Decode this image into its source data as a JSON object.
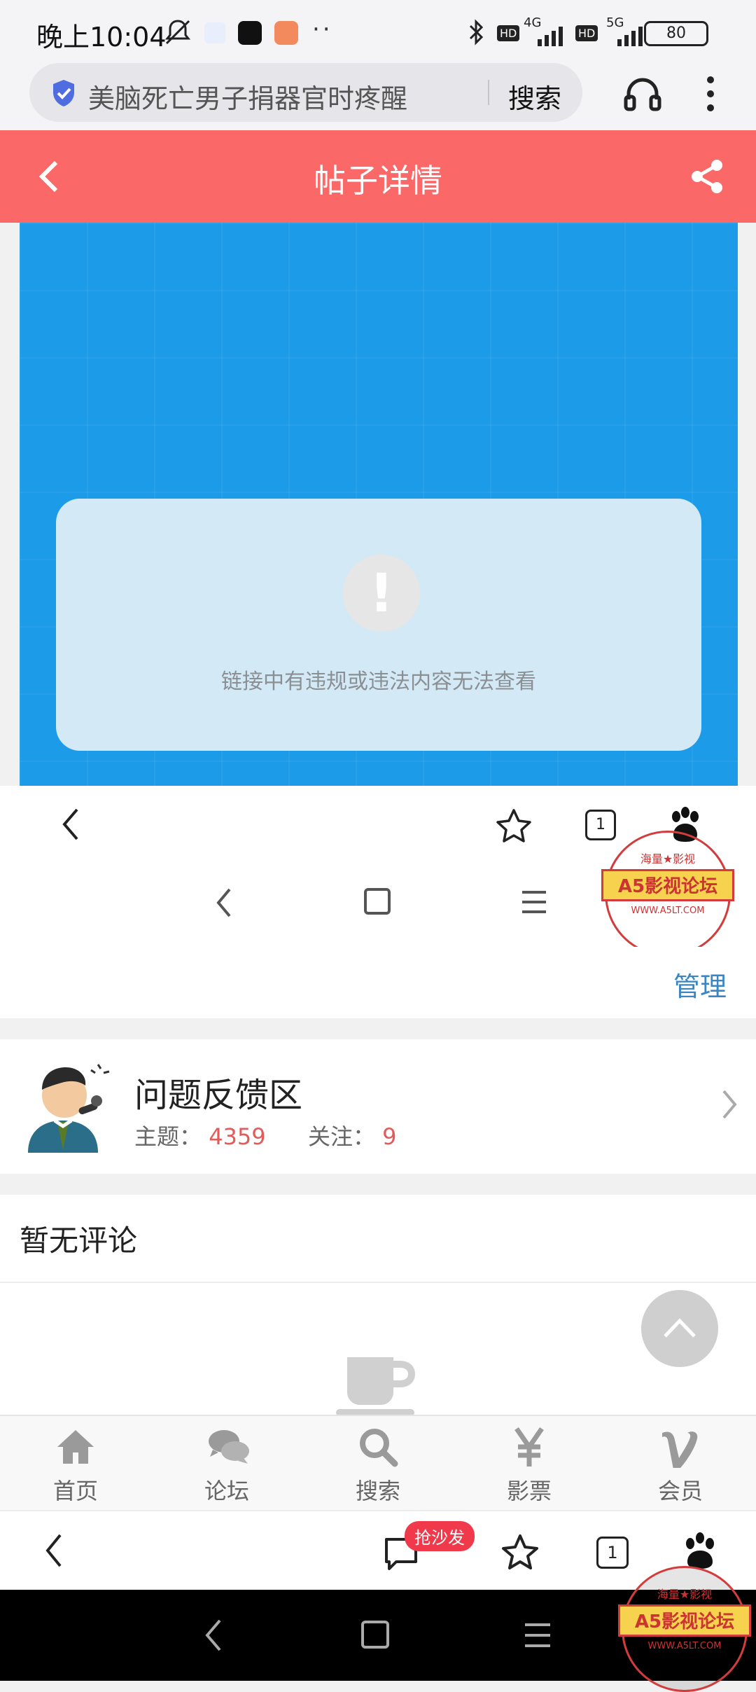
{
  "status_bar": {
    "time": "晚上10:04",
    "dots": "··",
    "battery": "80",
    "net1": "4G",
    "net2": "5G",
    "hd": "HD"
  },
  "browser": {
    "search_query": "美脑死亡男子捐器官时疼醒",
    "search_button": "搜索"
  },
  "header": {
    "title": "帖子详情"
  },
  "notice": {
    "message": "链接中有违规或违法内容无法查看",
    "mark": "!"
  },
  "embedded_bar": {
    "tab_count": "1"
  },
  "manage": {
    "label": "管理"
  },
  "forum": {
    "name": "问题反馈区",
    "topics_label": "主题：",
    "topics_value": "4359",
    "follow_label": "关注：",
    "follow_value": "9"
  },
  "comments": {
    "empty_label": "暂无评论"
  },
  "tabs": [
    {
      "label": "首页",
      "icon": "home-icon"
    },
    {
      "label": "论坛",
      "icon": "forum-icon"
    },
    {
      "label": "搜索",
      "icon": "search-icon"
    },
    {
      "label": "影票",
      "icon": "yen-icon"
    },
    {
      "label": "会员",
      "icon": "vip-icon"
    }
  ],
  "bottom_bar": {
    "sofa_badge": "抢沙发",
    "tab_count": "1"
  },
  "watermark": {
    "title": "A5影视论坛",
    "top": "海量★影视",
    "url": "WWW.A5LT.COM"
  },
  "colors": {
    "header": "#fb6868",
    "content_blue": "#1b9be8",
    "accent_red": "#e25b5b",
    "link_blue": "#3a86c4"
  }
}
